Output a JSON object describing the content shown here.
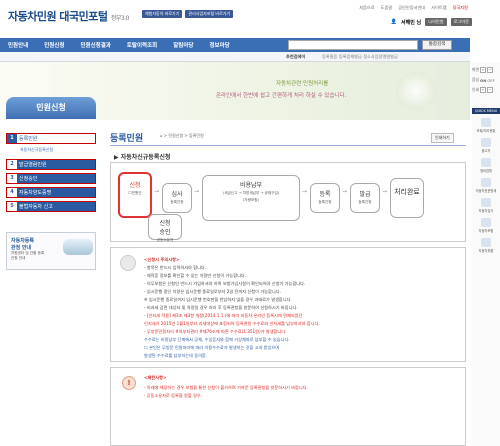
{
  "header": {
    "logo": "자동차민원 대국민포털",
    "logo_sub": "정부3.0",
    "logo_btn1": "체험자동차 바로가기",
    "logo_btn2": "관리사업자포털 바로가기",
    "toplinks": [
      "처음으로",
      "도움말",
      "공인인증서안내",
      "사이트맵"
    ],
    "toplink_red": "장국지원",
    "user": "서해민 님",
    "btn1": "나의민원",
    "btn2": "로그아웃"
  },
  "nav": {
    "items": [
      "민원안내",
      "민원신청",
      "민원신청결과",
      "토탈이력조회",
      "알림마당",
      "정보마당"
    ],
    "search_btn": "통합검색"
  },
  "subnav": {
    "label": "추천검색어",
    "links": "등록필증  등록증재발급  정소사업장명령발급"
  },
  "banner": {
    "line1": "자동차관련 민원처리를",
    "line2": "온라인에서 한번에 쉽고 간편하게 처리 하실 수 있습니다."
  },
  "right_panel": {
    "ctrl1": "화면",
    "ctrl2": "음성",
    "on": "ON",
    "off": "OFF",
    "print": "인쇄",
    "quick": "QUICK MENU",
    "items": [
      "조회/처리현황",
      "중고차",
      "정비업체",
      "자동차표준명세",
      "자동차검사",
      "자동차보험",
      "자동차부품"
    ]
  },
  "left": {
    "title": "민원신청",
    "menu": [
      {
        "n": "1",
        "label": "등록민원"
      },
      {
        "n": "2",
        "label": "발급열람민원"
      },
      {
        "n": "3",
        "label": "신청승인"
      },
      {
        "n": "4",
        "label": "자동차양도증명"
      },
      {
        "n": "5",
        "label": "불법자동차 신고"
      }
    ],
    "submenu": "자동차신규등록신청",
    "box_title": "자동차등록",
    "box_title2": "관청 안내",
    "box_desc": "지원센터 및 관할 등록",
    "box_desc2": "관청 안내"
  },
  "main": {
    "title": "등록민원",
    "breadcrumb": "⌂ > 민원신청 > 등록민원",
    "print": "인쇄하기",
    "section": "자동차신규등록신청",
    "flow": {
      "s1": "신청",
      "s1b": "민원인",
      "s2": "심사",
      "s2b": "등록관청",
      "s3": "비용납부",
      "s3b": "(세금신고 → 지방세납부 → 공채구입)",
      "s3c": "(차량보험)",
      "s4": "등록",
      "s4b": "등록관청",
      "s5": "발급",
      "s5b": "등록관청",
      "s6": "처리완료",
      "s7": "신청",
      "s7a": "승인",
      "s7b": "공동소유자"
    },
    "notes": [
      {
        "cls": "head",
        "text": "<신청시 주의사항>"
      },
      {
        "cls": "",
        "text": "- 항목은 반드시 입력하셔야 합니다."
      },
      {
        "cls": "",
        "text": "- 제작증 정보를 확인할 수 있는 차량만 신청이 가능합니다."
      },
      {
        "cls": "",
        "text": "- 의무보험은 신청인 반드시 가입하셔야 하며 보험가입사실이 확인되어야 신청이 가능합니다."
      },
      {
        "cls": "",
        "text": "- 임시운행 중인 차량은 임시운행 종료일로부터 2일 전까지 신청이 가능합니다."
      },
      {
        "cls": "",
        "text": "※ 임시운행 종료일까지 임시운행 번호판을 반납하지 않을 경우 과태료가 발생합니다."
      },
      {
        "cls": "",
        "text": "- 비과세 감면 대상자 및 차량일 경우 처리 후 등록관청을 방문하여 신청하시기 바랍니다."
      },
      {
        "cls": "red",
        "text": "- [인지세 적용] 제3조 제3항 개정(2014.1.1.)에 따라 자동차 온라인 등록시에 면제되었던"
      },
      {
        "cls": "red",
        "text": "  인지세가 2015년 1월1일부터 과세대상에 포함되어 등록관청 수수료와 인지세를 납부하셔야 합니다."
      },
      {
        "cls": "red",
        "text": "- 무방문민원처리 #처부처관리 #제76조에 따른 수수료(1,351원)가 발생합니다."
      },
      {
        "cls": "blue",
        "text": "  수수료는 비용납부 단계에서 공채, 수입증지와 함께 가상계좌로 납부할 수 있습니다."
      },
      {
        "cls": "blue",
        "text": "☐ 본인은 무방문 민원처리에 따라 이용수수료가 발생하는 것을 고지 받았으며"
      },
      {
        "cls": "blue",
        "text": "   발생된 수수료를 납부하는데 동의함."
      },
      {
        "cls": "head",
        "text": "<초벌이처시간>"
      },
      {
        "cls": "",
        "text": "평일 09:00 ~ 16:00 (※ 토·일·공휴일 이용불가)"
      }
    ],
    "warn_head": "<제한사항>",
    "warn1": "- 아래에 해당하는 경우 보험을 통한 신청이 불가하며 가까운 등록관청을 방문하시기 바랍니다.",
    "warn2": "· 공동소유자로 등록을 원할 경우"
  }
}
